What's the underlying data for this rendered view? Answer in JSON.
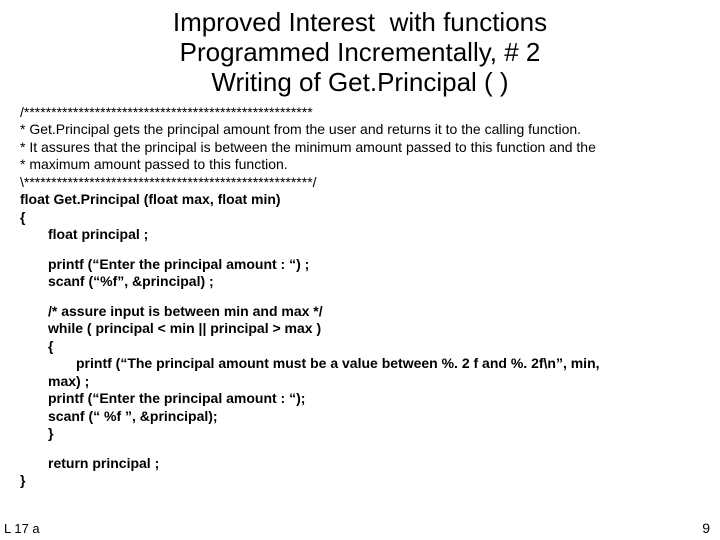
{
  "title": {
    "line1": "Improved Interest  with functions",
    "line2": "Programmed Incrementally, # 2",
    "line3": "Writing of Get.Principal ( )"
  },
  "comment": {
    "open": "/*****************************************************",
    "l1": "* Get.Principal gets the principal amount from the user and returns it to the calling function.",
    "l2": "* It assures that the principal is between the minimum amount passed to this function and the",
    "l3": "* maximum amount passed  to this function.",
    "close": "\\*****************************************************/"
  },
  "code": {
    "sig": "float Get.Principal (float max, float min)",
    "brace_open": "{",
    "decl": "float principal ;",
    "printf1": "printf (“Enter the principal amount : “) ;",
    "scanf1": "scanf (“%f”, &principal) ;",
    "cmt": "/* assure input is between min and max */",
    "while": "while ( principal < min || principal > max )",
    "while_open": "{",
    "err1": "printf (“The principal amount must be a value between %. 2 f and %. 2f\\n”, min,",
    "err2": "max) ;",
    "printf2": "printf (“Enter the principal amount : “);",
    "scanf2": "scanf (“ %f ”, &principal);",
    "while_close": "}",
    "ret": "return principal ;",
    "brace_close": "}"
  },
  "footer": {
    "left": "L 17 a",
    "right": "9"
  }
}
